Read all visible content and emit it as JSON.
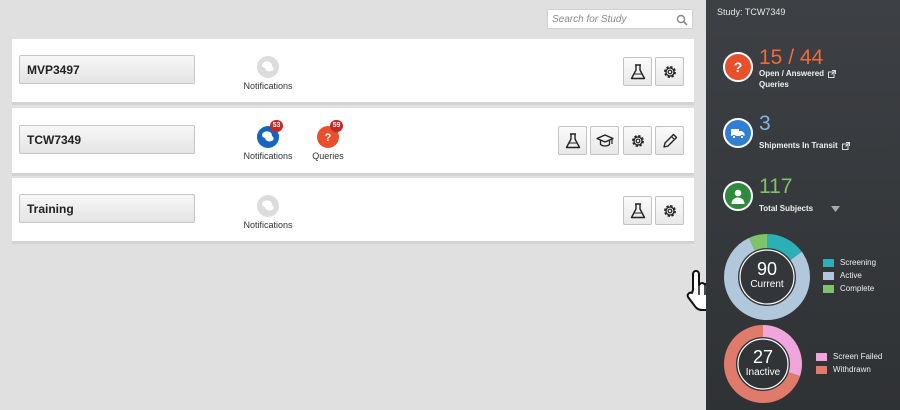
{
  "search": {
    "placeholder": "Search for Study",
    "icon": "search-icon"
  },
  "studies": [
    {
      "name": "MVP3497",
      "notifications_label": "Notifications"
    },
    {
      "name": "TCW7349",
      "notifications_label": "Notifications",
      "notifications_count": "53",
      "queries_label": "Queries",
      "queries_count": "59"
    },
    {
      "name": "Training",
      "notifications_label": "Notifications"
    }
  ],
  "panel": {
    "title": "Study: TCW7349",
    "queries": {
      "value": "15 / 44",
      "label_line1": "Open / Answered",
      "label_line2": "Queries",
      "color": "#f06b3b"
    },
    "shipments": {
      "value": "3",
      "label": "Shipments In Transit",
      "color": "#7eb6e8"
    },
    "subjects": {
      "value": "117",
      "label": "Total Subjects",
      "color": "#7cc36a"
    },
    "current": {
      "value": "90",
      "label": "Current",
      "segments": [
        {
          "name": "Screening",
          "color": "#2ab0b6",
          "fraction": 0.15
        },
        {
          "name": "Active",
          "color": "#b1c8dc",
          "fraction": 0.78
        },
        {
          "name": "Complete",
          "color": "#7cc36a",
          "fraction": 0.07
        }
      ]
    },
    "inactive": {
      "value": "27",
      "label": "Inactive",
      "segments": [
        {
          "name": "Screen Failed",
          "color": "#f0a6dc",
          "fraction": 0.3
        },
        {
          "name": "Withdrawn",
          "color": "#e07b6c",
          "fraction": 0.7
        }
      ]
    }
  },
  "colors": {
    "notification_active": "#1565c0",
    "query_active": "#e8502c",
    "notification_idle": "#dcdcdc",
    "badge": "#c62828"
  }
}
